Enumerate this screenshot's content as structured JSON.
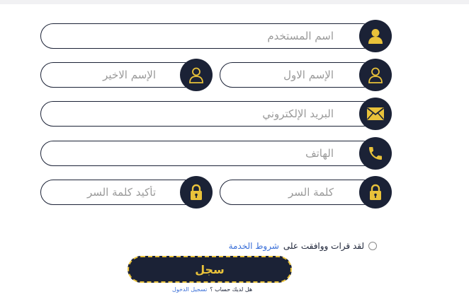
{
  "form": {
    "username": {
      "placeholder": "اسم المستخدم",
      "icon": "user-solid-icon"
    },
    "first_name": {
      "placeholder": "الإسم الاول",
      "icon": "user-outline-icon"
    },
    "last_name": {
      "placeholder": "الإسم الاخير",
      "icon": "user-outline-icon"
    },
    "email": {
      "placeholder": "البريد الإلكتروني",
      "icon": "envelope-icon"
    },
    "phone": {
      "placeholder": "الهاتف",
      "icon": "phone-icon"
    },
    "password": {
      "placeholder": "كلمة السر",
      "icon": "lock-icon"
    },
    "confirm_password": {
      "placeholder": "تأكيد كلمة السر",
      "icon": "lock-icon"
    }
  },
  "terms": {
    "text": "لقد  قرات ووافقت على",
    "link": "شروط الخدمة"
  },
  "register_button": "سجل",
  "login_prompt": {
    "text": "هل لديك حساب ؟",
    "link": "تسجيل الدخول"
  },
  "colors": {
    "primary": "#1b2236",
    "accent": "#e9c23a",
    "link": "#3a6fd8"
  }
}
